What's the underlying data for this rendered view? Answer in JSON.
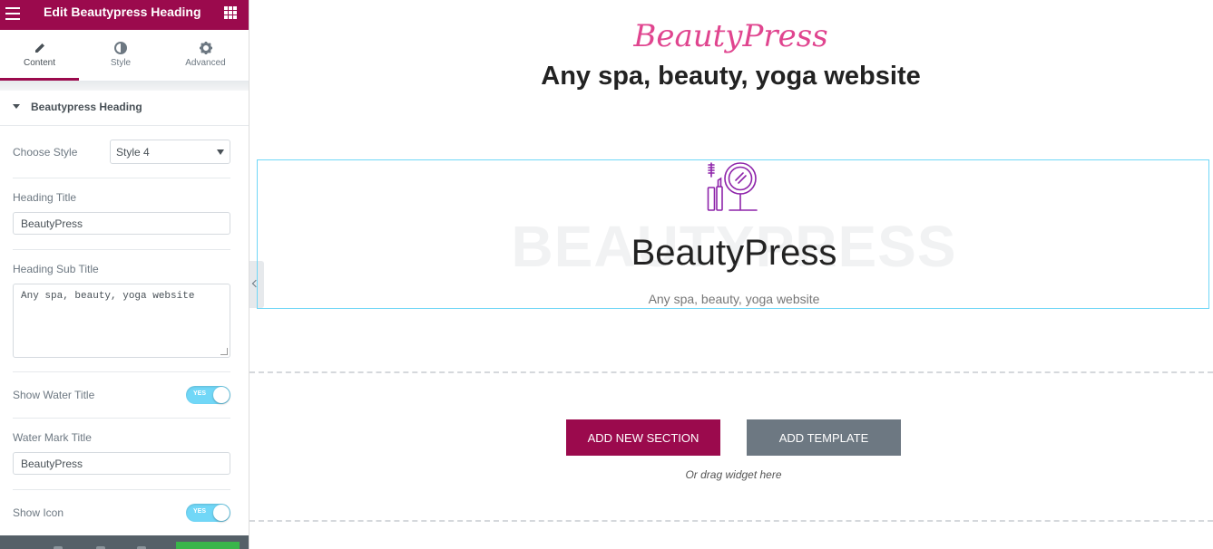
{
  "panel": {
    "title": "Edit Beautypress Heading",
    "tabs": [
      {
        "label": "Content",
        "icon": "pencil-icon",
        "active": true
      },
      {
        "label": "Style",
        "icon": "half-circle-icon",
        "active": false
      },
      {
        "label": "Advanced",
        "icon": "gear-icon",
        "active": false
      }
    ],
    "section_title": "Beautypress Heading",
    "controls": {
      "choose_style_label": "Choose Style",
      "choose_style_value": "Style 4",
      "heading_title_label": "Heading Title",
      "heading_title_value": "BeautyPress",
      "heading_sub_title_label": "Heading Sub Title",
      "heading_sub_title_value": "Any spa, beauty, yoga website",
      "show_water_title_label": "Show Water Title",
      "show_water_title_state": "YES",
      "water_mark_title_label": "Water Mark Title",
      "water_mark_title_value": "BeautyPress",
      "show_icon_label": "Show Icon",
      "show_icon_state": "YES"
    }
  },
  "preview": {
    "brand_script": "BeautyPress",
    "page_heading": "Any spa, beauty, yoga website",
    "widget": {
      "icon": "cosmetics-mirror-mascara-icon",
      "watermark": "BEAUTYPRESS",
      "title": "BeautyPress",
      "subtitle": "Any spa, beauty, yoga website"
    },
    "add_section_label": "ADD NEW SECTION",
    "add_template_label": "ADD TEMPLATE",
    "drag_hint": "Or drag widget here"
  },
  "colors": {
    "accent": "#9b0a4d",
    "brand_pink": "#e0458f",
    "switch_on": "#71d7f7",
    "icon_purple": "#8e24aa"
  }
}
